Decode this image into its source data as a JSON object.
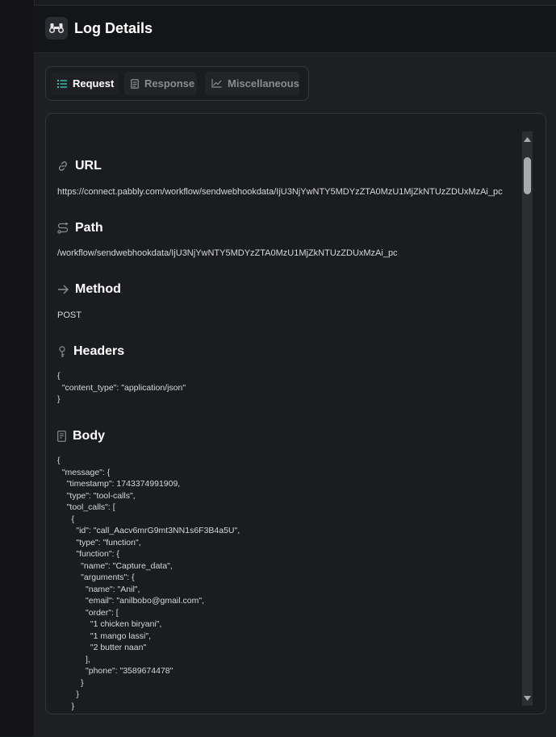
{
  "header": {
    "title": "Log Details"
  },
  "tabs": [
    {
      "label": "Request",
      "active": true
    },
    {
      "label": "Response",
      "active": false
    },
    {
      "label": "Miscellaneous",
      "active": false
    }
  ],
  "sections": {
    "url": {
      "title": "URL",
      "value": "https://connect.pabbly.com/workflow/sendwebhookdata/IjU3NjYwNTY5MDYzZTA0MzU1MjZkNTUzZDUxMzAi_pc"
    },
    "path": {
      "title": "Path",
      "value": "/workflow/sendwebhookdata/IjU3NjYwNTY5MDYzZTA0MzU1MjZkNTUzZDUxMzAi_pc"
    },
    "method": {
      "title": "Method",
      "value": "POST"
    },
    "headers": {
      "title": "Headers",
      "value": "{\n  \"content_type\": \"application/json\"\n}"
    },
    "body": {
      "title": "Body",
      "value": "{\n  \"message\": {\n    \"timestamp\": 1743374991909,\n    \"type\": \"tool-calls\",\n    \"tool_calls\": [\n      {\n        \"id\": \"call_Aacv6mrG9mt3NN1s6F3B4a5U\",\n        \"type\": \"function\",\n        \"function\": {\n          \"name\": \"Capture_data\",\n          \"arguments\": {\n            \"name\": \"Anil\",\n            \"email\": \"anilbobo@gmail.com\",\n            \"order\": [\n              \"1 chicken biryani\",\n              \"1 mango lassi\",\n              \"2 butter naan\"\n            ],\n            \"phone\": \"3589674478\"\n          }\n        }\n      }\n    ]"
    }
  },
  "colors": {
    "background": "#1a1b1e",
    "header_bg": "#141518",
    "text": "#ffffff",
    "muted": "#8a8b91"
  }
}
